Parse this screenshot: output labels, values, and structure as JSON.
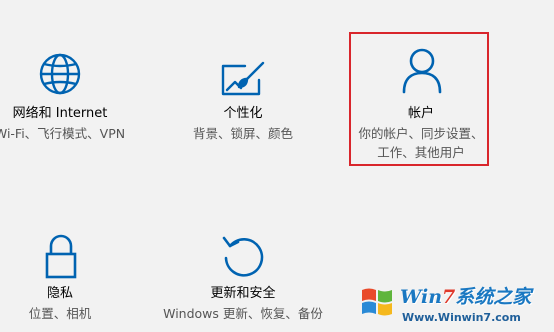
{
  "tiles": [
    {
      "id": "network",
      "title": "网络和 Internet",
      "description": "Wi-Fi、飞行模式、VPN",
      "icon": "globe-icon"
    },
    {
      "id": "personalization",
      "title": "个性化",
      "description": "背景、锁屏、颜色",
      "icon": "personalization-icon"
    },
    {
      "id": "accounts",
      "title": "帐户",
      "description_line1": "你的帐户、同步设置、",
      "description_line2": "工作、其他用户",
      "icon": "person-icon",
      "highlighted": true
    },
    {
      "id": "privacy",
      "title": "隐私",
      "description": "位置、相机",
      "icon": "lock-icon"
    },
    {
      "id": "update",
      "title": "更新和安全",
      "description": "Windows 更新、恢复、备份",
      "icon": "refresh-icon"
    }
  ],
  "watermark": {
    "logo_prefix": "Win",
    "logo_seven": "7",
    "logo_suffix": "系统之家",
    "url": "Www.Winwin7.com"
  },
  "colors": {
    "accent": "#0063b1",
    "highlight": "#d9262c",
    "background": "#f2f2f2"
  }
}
